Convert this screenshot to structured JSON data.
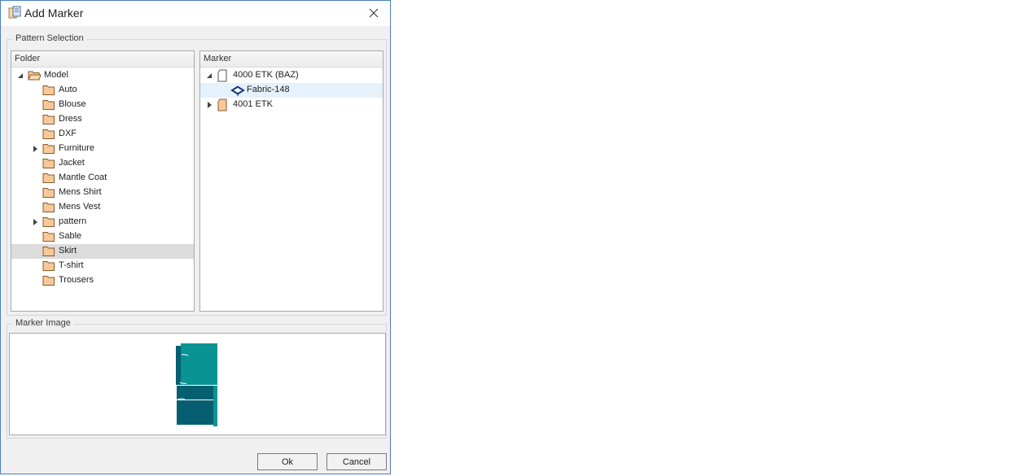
{
  "window": {
    "title": "Add Marker",
    "close_icon": "close-icon",
    "app_icon": "marker-app-icon"
  },
  "pattern_selection": {
    "group_title": "Pattern Selection",
    "folder_panel": {
      "header": "Folder",
      "root": {
        "label": "Model",
        "expanded": true,
        "icon": "open-folder-icon"
      },
      "children": [
        {
          "label": "Auto",
          "has_children": false
        },
        {
          "label": "Blouse",
          "has_children": false
        },
        {
          "label": "Dress",
          "has_children": false
        },
        {
          "label": "DXF",
          "has_children": false
        },
        {
          "label": "Furniture",
          "has_children": true
        },
        {
          "label": "Jacket",
          "has_children": false
        },
        {
          "label": "Mantle Coat",
          "has_children": false
        },
        {
          "label": "Mens Shirt",
          "has_children": false
        },
        {
          "label": "Mens Vest",
          "has_children": false
        },
        {
          "label": "pattern",
          "has_children": true
        },
        {
          "label": "Sable",
          "has_children": false
        },
        {
          "label": "Skirt",
          "has_children": false,
          "selected": true
        },
        {
          "label": "T-shirt",
          "has_children": false
        },
        {
          "label": "Trousers",
          "has_children": false
        }
      ]
    },
    "marker_panel": {
      "header": "Marker",
      "items": [
        {
          "label": "4000 ETK (BAZ)",
          "expanded": true,
          "icon": "document-icon",
          "children": [
            {
              "label": "Fabric-148",
              "icon": "fabric-icon",
              "highlighted": true
            }
          ]
        },
        {
          "label": "4001 ETK",
          "expanded": false,
          "icon": "document-filled-icon"
        }
      ]
    }
  },
  "marker_image": {
    "group_title": "Marker Image",
    "colors": {
      "light": "#0a9393",
      "dark": "#055f70"
    }
  },
  "buttons": {
    "ok": "Ok",
    "cancel": "Cancel"
  }
}
